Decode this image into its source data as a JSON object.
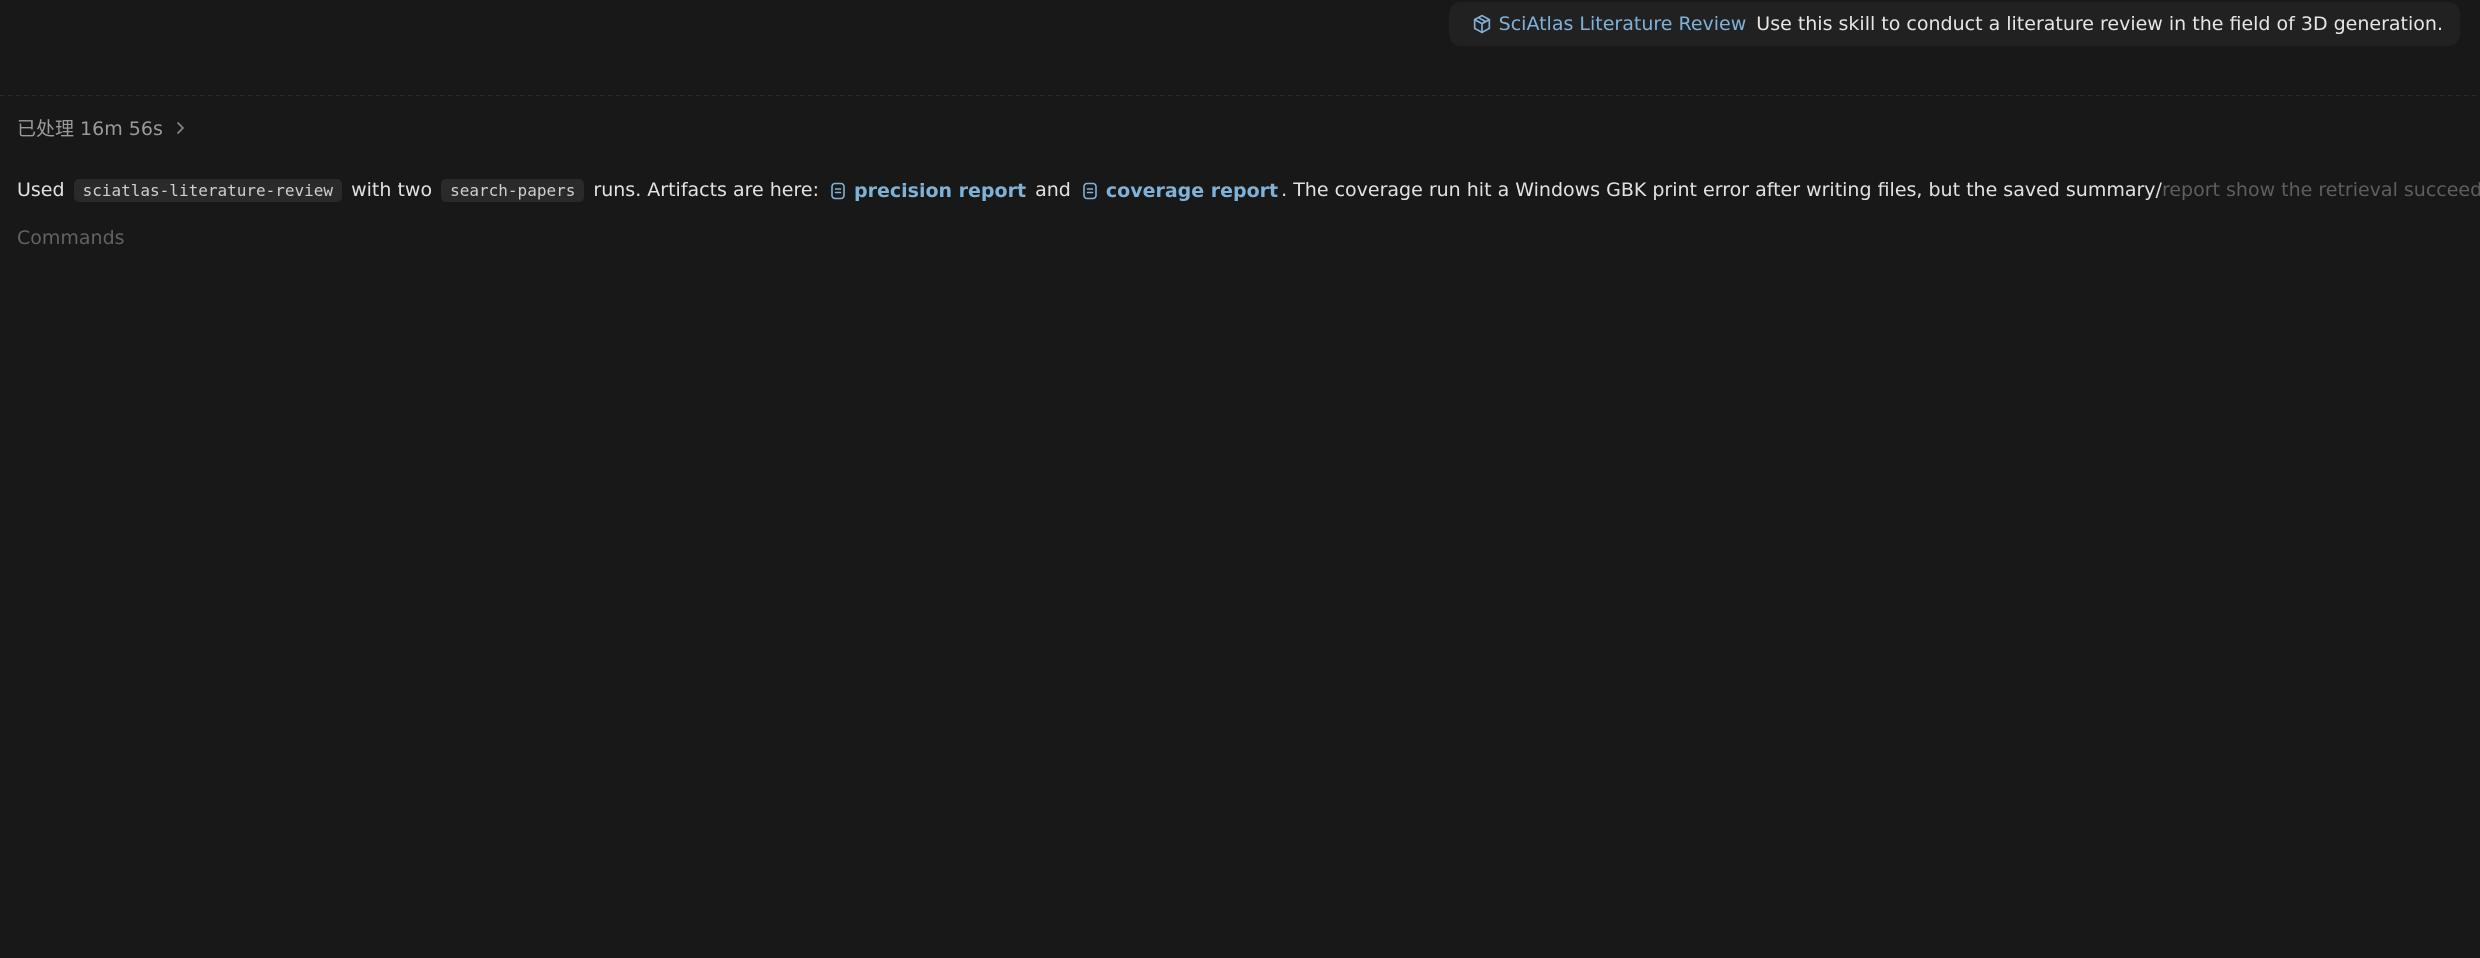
{
  "skill_chip": {
    "icon": "package-icon",
    "name": "SciAtlas Literature Review",
    "description": "Use this skill to conduct a literature review in the field of 3D generation."
  },
  "status": {
    "processed_text": "已处理 16m 56s",
    "chevron_icon": "chevron-right-icon"
  },
  "message": {
    "part1": "Used",
    "code1": "sciatlas-literature-review",
    "part2": "with two",
    "code2": "search-papers",
    "part3": "runs. Artifacts are here:",
    "link1": "precision report",
    "part4": "and",
    "link2": "coverage report",
    "part5": ". The coverage run hit a Windows GBK print error after writing files, but the saved summary/",
    "faded_tail": "report show the retrieval succeeded.",
    "file_icon": "file-text-icon"
  },
  "commands_label": "Commands",
  "colors": {
    "background": "#181818",
    "link": "#7fb2d9",
    "chip_background": "#212121"
  }
}
